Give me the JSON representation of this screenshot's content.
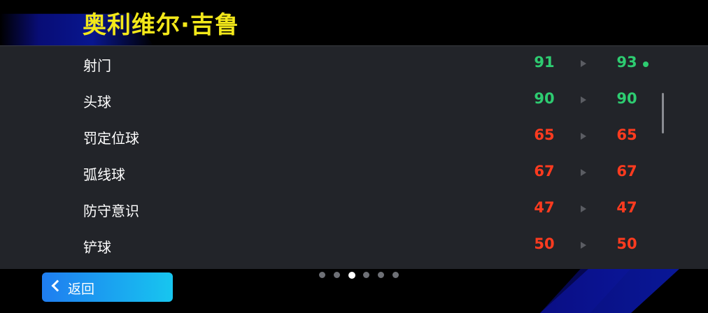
{
  "header": {
    "player_name": "奥利维尔·吉鲁"
  },
  "colors": {
    "high": "#2ecc71",
    "low": "#ff3b1f",
    "name": "#f3e81a",
    "button": "#1aa8f0"
  },
  "stats": [
    {
      "label": "射门",
      "before": "91",
      "after": "93",
      "level": "high",
      "increased": true
    },
    {
      "label": "头球",
      "before": "90",
      "after": "90",
      "level": "high",
      "increased": false
    },
    {
      "label": "罚定位球",
      "before": "65",
      "after": "65",
      "level": "low",
      "increased": false
    },
    {
      "label": "弧线球",
      "before": "67",
      "after": "67",
      "level": "low",
      "increased": false
    },
    {
      "label": "防守意识",
      "before": "47",
      "after": "47",
      "level": "low",
      "increased": false
    },
    {
      "label": "铲球",
      "before": "50",
      "after": "50",
      "level": "low",
      "increased": false
    }
  ],
  "pager": {
    "total": 6,
    "current": 3
  },
  "footer": {
    "back_label": "返回",
    "back_icon": "chevron-left-icon"
  }
}
